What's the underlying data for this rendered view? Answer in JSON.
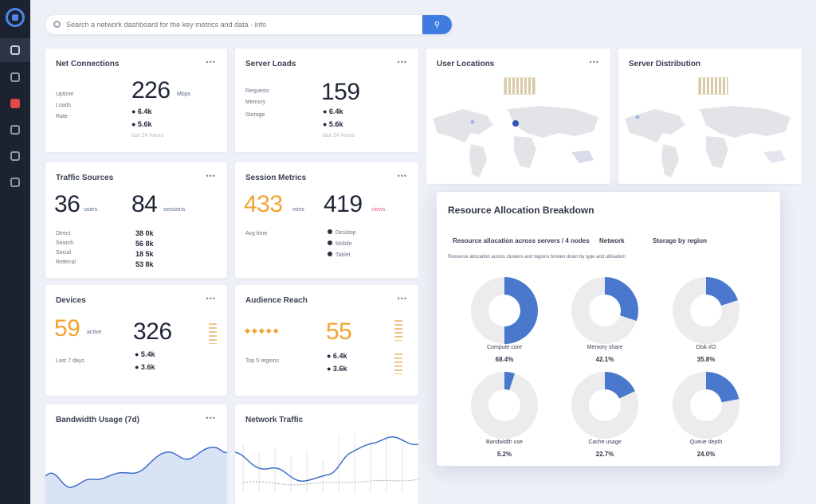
{
  "colors": {
    "accent": "#3f7be0",
    "orange": "#f4a233",
    "navy": "#1d2230",
    "donut_fill": "#4a78cc",
    "donut_track": "#ececee"
  },
  "search": {
    "placeholder": "Search a network dashboard for the key metrics and data · info",
    "button_icon": "search-icon"
  },
  "sidebar": {
    "items": [
      {
        "icon": "grid-icon"
      },
      {
        "icon": "list-icon"
      },
      {
        "icon": "alert-icon"
      },
      {
        "icon": "chart-icon"
      },
      {
        "icon": "users-icon"
      },
      {
        "icon": "settings-icon"
      }
    ]
  },
  "cards": {
    "c1": {
      "title": "Net Connections",
      "menu": "•••",
      "big": "226",
      "unit": "Mbps",
      "labels": [
        "Uptime",
        "Loads",
        "Rate"
      ],
      "values": [
        "● 6.4k",
        "● 5.6k"
      ],
      "note": "last 24 hours"
    },
    "c2": {
      "title": "Server Loads",
      "menu": "•••",
      "big": "159",
      "labels": [
        "Requests",
        "Memory",
        "Storage"
      ],
      "values": [
        "● 6.4k",
        "● 5.6k"
      ],
      "note": "last 24 hours"
    },
    "c3": {
      "title": "Traffic Sources",
      "menu": "•••",
      "big1": "36",
      "unit1": "users",
      "big2": "84",
      "unit2": "sessions",
      "labels": [
        "Direct",
        "Search",
        "Social",
        "Referral"
      ],
      "values": [
        "38 0k",
        "56 8k",
        "18 5k",
        "53 8k"
      ]
    },
    "c4": {
      "title": "Session Metrics",
      "menu": "•••",
      "big1": "433",
      "unit1": "mins",
      "big2": "419",
      "unit2": "views",
      "sub": "Avg time",
      "legend": [
        "Desktop",
        "Mobile",
        "Tablet"
      ]
    },
    "c5": {
      "title": "Devices",
      "menu": "•••",
      "big1": "59",
      "unit1": "active",
      "big2": "326",
      "note": "Last 7 days",
      "values": [
        "● 5.4k",
        "● 3.6k"
      ]
    },
    "c6": {
      "title": "Audience Reach",
      "menu": "•••",
      "big": "55",
      "stars": "◆◆◆◆◆",
      "note": "Top 5 regions",
      "values": [
        "● 6.4k",
        "● 3.6k"
      ]
    },
    "c7": {
      "title": "Bandwidth Usage (7d)",
      "menu": "•••"
    },
    "c8": {
      "title": "Network Traffic",
      "menu": "•••"
    },
    "m1": {
      "title": "User Locations",
      "menu": "•••"
    },
    "m2": {
      "title": "Server Distribution",
      "menu": "•••"
    }
  },
  "panel": {
    "title": "Resource Allocation Breakdown",
    "filters": [
      "Resource allocation across servers / 4 nodes",
      "Network",
      "Storage by region"
    ],
    "sub": "Resource allocation across clusters and regions broken down by type and utilisation",
    "donuts": [
      {
        "caption": "Compute core",
        "value": "68.4%",
        "fraction": 0.5
      },
      {
        "caption": "Memory share",
        "value": "42.1%",
        "fraction": 0.3
      },
      {
        "caption": "Disk I/O",
        "value": "35.8%",
        "fraction": 0.2
      },
      {
        "caption": "Bandwidth use",
        "value": "5.2%",
        "fraction": 0.05
      },
      {
        "caption": "Cache usage",
        "value": "22.7%",
        "fraction": 0.18
      },
      {
        "caption": "Queue depth",
        "value": "24.0%",
        "fraction": 0.22
      }
    ]
  }
}
